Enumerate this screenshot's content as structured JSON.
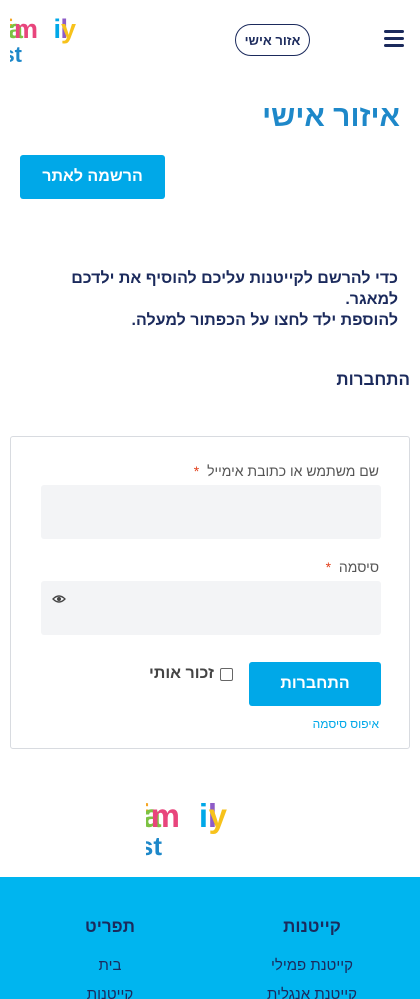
{
  "header": {
    "brand": "family first",
    "personal_area_button": "אזור אישי"
  },
  "page": {
    "title": "איזור אישי",
    "register_button": "הרשמה לאתר",
    "info_line1": "כדי להרשם לקייטנות עליכם להוסיף את ילדכם למאגר.",
    "info_line2": "להוספת ילד לחצו על הכפתור למעלה.",
    "login_heading": "התחברות"
  },
  "login_form": {
    "username_label": "שם משתמש או כתובת אימייל",
    "username_value": "",
    "password_label": "סיסמה",
    "password_value": "",
    "required_mark": "*",
    "submit_button": "התחברות",
    "remember_label": "זכור אותי",
    "remember_checked": false,
    "lost_password_link": "איפוס סיסמה"
  },
  "footer": {
    "brand": "family first",
    "columns": [
      {
        "title": "קייטנות",
        "items": [
          "קייטנת פמילי",
          "קייטנת אנגלית"
        ]
      },
      {
        "title": "תפריט",
        "items": [
          "בית",
          "קייטנות"
        ]
      }
    ]
  },
  "colors": {
    "primary": "#00a8e8",
    "navy": "#1b2a5c",
    "title_blue": "#1e88c9",
    "footer_bg": "#00b5ef",
    "required": "#e2401c"
  }
}
